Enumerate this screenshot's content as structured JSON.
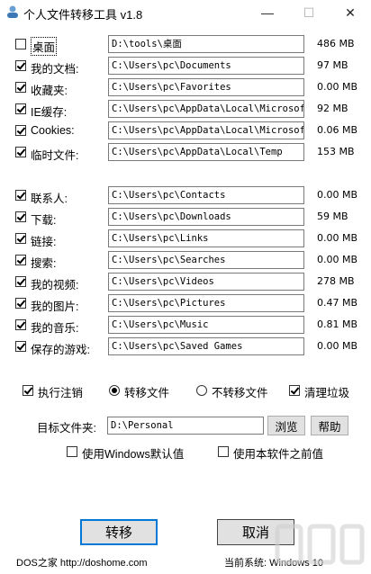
{
  "window": {
    "title": "个人文件转移工具 v1.8",
    "min": "—",
    "max": "☐",
    "close": "✕"
  },
  "folders_a": [
    {
      "label": "桌面",
      "checked": false,
      "path": "D:\\tools\\桌面",
      "size": "486 MB"
    },
    {
      "label": "我的文档:",
      "checked": true,
      "path": "C:\\Users\\pc\\Documents",
      "size": "97 MB"
    },
    {
      "label": "收藏夹:",
      "checked": true,
      "path": "C:\\Users\\pc\\Favorites",
      "size": "0.00 MB"
    },
    {
      "label": "IE缓存:",
      "checked": true,
      "path": "C:\\Users\\pc\\AppData\\Local\\Microsoft\\",
      "size": "92 MB"
    },
    {
      "label": "Cookies:",
      "checked": true,
      "path": "C:\\Users\\pc\\AppData\\Local\\Microsoft\\",
      "size": "0.06 MB"
    },
    {
      "label": "临时文件:",
      "checked": true,
      "path": "C:\\Users\\pc\\AppData\\Local\\Temp",
      "size": "153 MB"
    }
  ],
  "folders_b": [
    {
      "label": "联系人:",
      "checked": true,
      "path": "C:\\Users\\pc\\Contacts",
      "size": "0.00 MB"
    },
    {
      "label": "下载:",
      "checked": true,
      "path": "C:\\Users\\pc\\Downloads",
      "size": "59 MB"
    },
    {
      "label": "链接:",
      "checked": true,
      "path": "C:\\Users\\pc\\Links",
      "size": "0.00 MB"
    },
    {
      "label": "搜索:",
      "checked": true,
      "path": "C:\\Users\\pc\\Searches",
      "size": "0.00 MB"
    },
    {
      "label": "我的视频:",
      "checked": true,
      "path": "C:\\Users\\pc\\Videos",
      "size": "278 MB"
    },
    {
      "label": "我的图片:",
      "checked": true,
      "path": "C:\\Users\\pc\\Pictures",
      "size": "0.47 MB"
    },
    {
      "label": "我的音乐:",
      "checked": true,
      "path": "C:\\Users\\pc\\Music",
      "size": "0.81 MB"
    },
    {
      "label": "保存的游戏:",
      "checked": true,
      "path": "C:\\Users\\pc\\Saved Games",
      "size": "0.00 MB"
    }
  ],
  "options": {
    "logoff_label": "执行注销",
    "transfer_label": "转移文件",
    "no_transfer_label": "不转移文件",
    "clean_label": "清理垃圾",
    "target_label": "目标文件夹:",
    "target_value": "D:\\Personal",
    "browse_label": "浏览",
    "help_label": "帮助",
    "use_windows_default": "使用Windows默认值",
    "use_previous": "使用本软件之前值"
  },
  "actions": {
    "transfer": "转移",
    "cancel": "取消"
  },
  "status": {
    "site": "DOS之家 http://doshome.com",
    "system": "当前系统: Windows 10"
  }
}
